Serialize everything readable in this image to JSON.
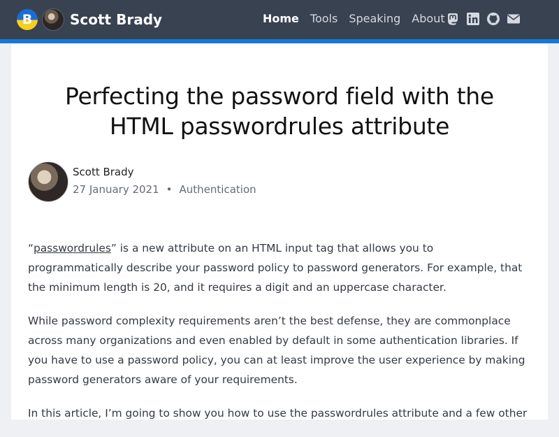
{
  "brand": {
    "logo_letter": "B",
    "name": "Scott Brady"
  },
  "nav": {
    "items": [
      {
        "label": "Home",
        "active": true
      },
      {
        "label": "Tools",
        "active": false
      },
      {
        "label": "Speaking",
        "active": false
      },
      {
        "label": "About",
        "active": false
      }
    ]
  },
  "social": [
    "mastodon-icon",
    "linkedin-icon",
    "github-icon",
    "email-icon"
  ],
  "colors": {
    "navbar": "#394250",
    "accent": "#1479d6"
  },
  "article": {
    "title_line1": "Perfecting the password field with the",
    "title_line2": "HTML passwordrules attribute",
    "author": "Scott Brady",
    "date": "27 January 2021",
    "separator": "•",
    "category": "Authentication",
    "p1_open_quote": "“",
    "p1_link": "passwordrules",
    "p1_rest": "” is a new attribute on an HTML input tag that allows you to programmatically describe your password policy to password generators. For example, that the minimum length is 20, and it requires a digit and an uppercase character.",
    "p2": "While password complexity requirements aren’t the best defense, they are commonplace across many organizations and even enabled by default in some authentication libraries. If you have to use a password policy, you can at least improve the user experience by making password generators aware of your requirements.",
    "p3": "In this article, I’m going to show you how to use the passwordrules attribute and a few other"
  }
}
